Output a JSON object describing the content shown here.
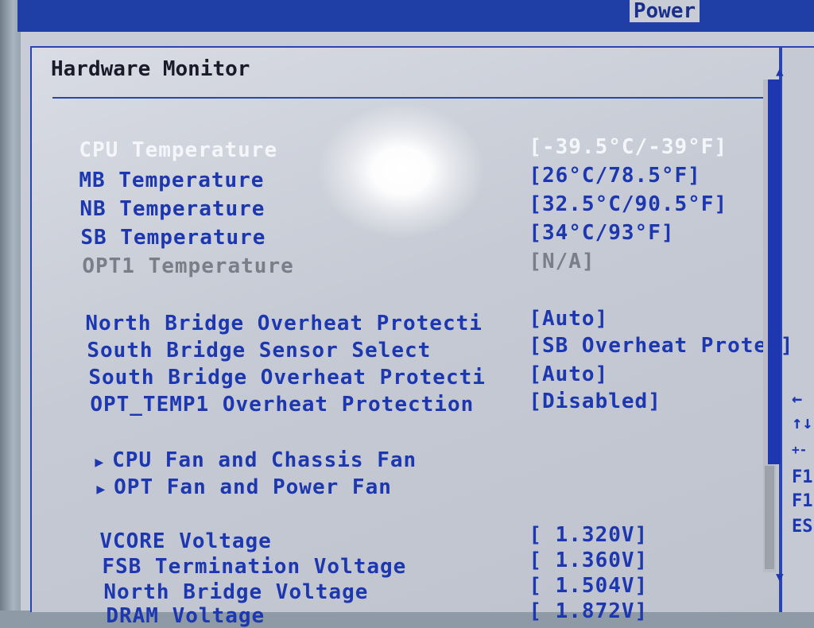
{
  "menu": {
    "active_tab": "Power"
  },
  "section": {
    "title": "Hardware Monitor"
  },
  "temperatures": [
    {
      "label": "CPU Temperature",
      "value": "[-39.5°C/-39°F]"
    },
    {
      "label": "MB Temperature",
      "value": "[26°C/78.5°F]"
    },
    {
      "label": "NB Temperature",
      "value": "[32.5°C/90.5°F]"
    },
    {
      "label": "SB Temperature",
      "value": "[34°C/93°F]"
    },
    {
      "label": "OPT1 Temperature",
      "value": "[N/A]"
    }
  ],
  "protection": [
    {
      "label": "North Bridge Overheat Protecti",
      "value": "[Auto]"
    },
    {
      "label": "South Bridge Sensor Select",
      "value": "[SB Overheat Protec]"
    },
    {
      "label": "South Bridge Overheat Protecti",
      "value": "[Auto]"
    },
    {
      "label": "OPT_TEMP1 Overheat Protection",
      "value": "[Disabled]"
    }
  ],
  "submenus": [
    {
      "label": "CPU Fan and Chassis Fan"
    },
    {
      "label": "OPT Fan and Power Fan"
    }
  ],
  "voltages": [
    {
      "label": "VCORE Voltage",
      "value": "[ 1.320V]"
    },
    {
      "label": "FSB Termination Voltage",
      "value": "[ 1.360V]"
    },
    {
      "label": "North Bridge Voltage",
      "value": "[ 1.504V]"
    },
    {
      "label": "DRAM Voltage",
      "value": "[ 1.872V]"
    }
  ],
  "help_keys": [
    "←",
    "↑↓",
    "+-",
    "F1",
    "F1",
    "ES"
  ],
  "icons": {
    "submenu_arrow": "▶",
    "scroll_up": "▲",
    "scroll_down": "▼"
  },
  "colors": {
    "text_blue": "#1c37b0",
    "header_blue": "#1f3fa6",
    "background": "#c8ccd6"
  }
}
